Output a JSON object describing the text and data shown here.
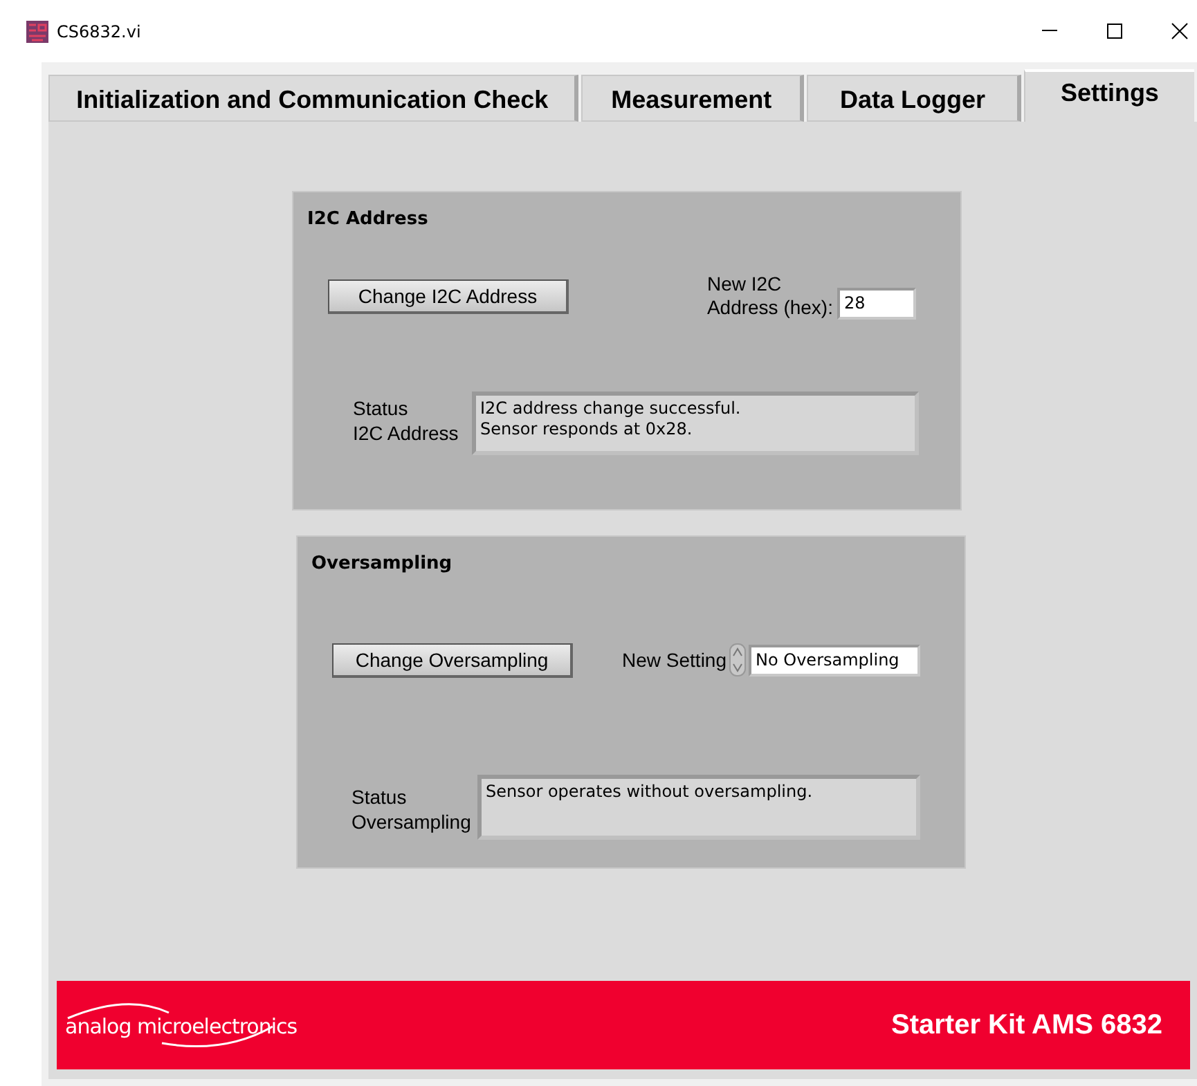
{
  "window": {
    "title": "CS6832.vi"
  },
  "tabs": [
    {
      "label": "Initialization and Communication Check",
      "selected": false
    },
    {
      "label": "Measurement",
      "selected": false
    },
    {
      "label": "Data Logger",
      "selected": false
    },
    {
      "label": "Settings",
      "selected": true
    }
  ],
  "groups": [
    {
      "title": "I2C Address",
      "button": "Change I2C Address",
      "field": {
        "kind": "numeric",
        "label": "New I2C\nAddress (hex):",
        "value": "28"
      },
      "status": {
        "label": "Status\nI2C Address",
        "text": "I2C address change successful.\nSensor responds at 0x28."
      }
    },
    {
      "title": "Oversampling",
      "button": "Change Oversampling",
      "field": {
        "kind": "ring",
        "label": "New Setting",
        "value": "No Oversampling"
      },
      "status": {
        "label": "Status\nOversampling",
        "text": "Sensor operates without oversampling."
      }
    }
  ],
  "footer": {
    "logo": "analog microelectronics",
    "title": "Starter Kit AMS 6832"
  }
}
